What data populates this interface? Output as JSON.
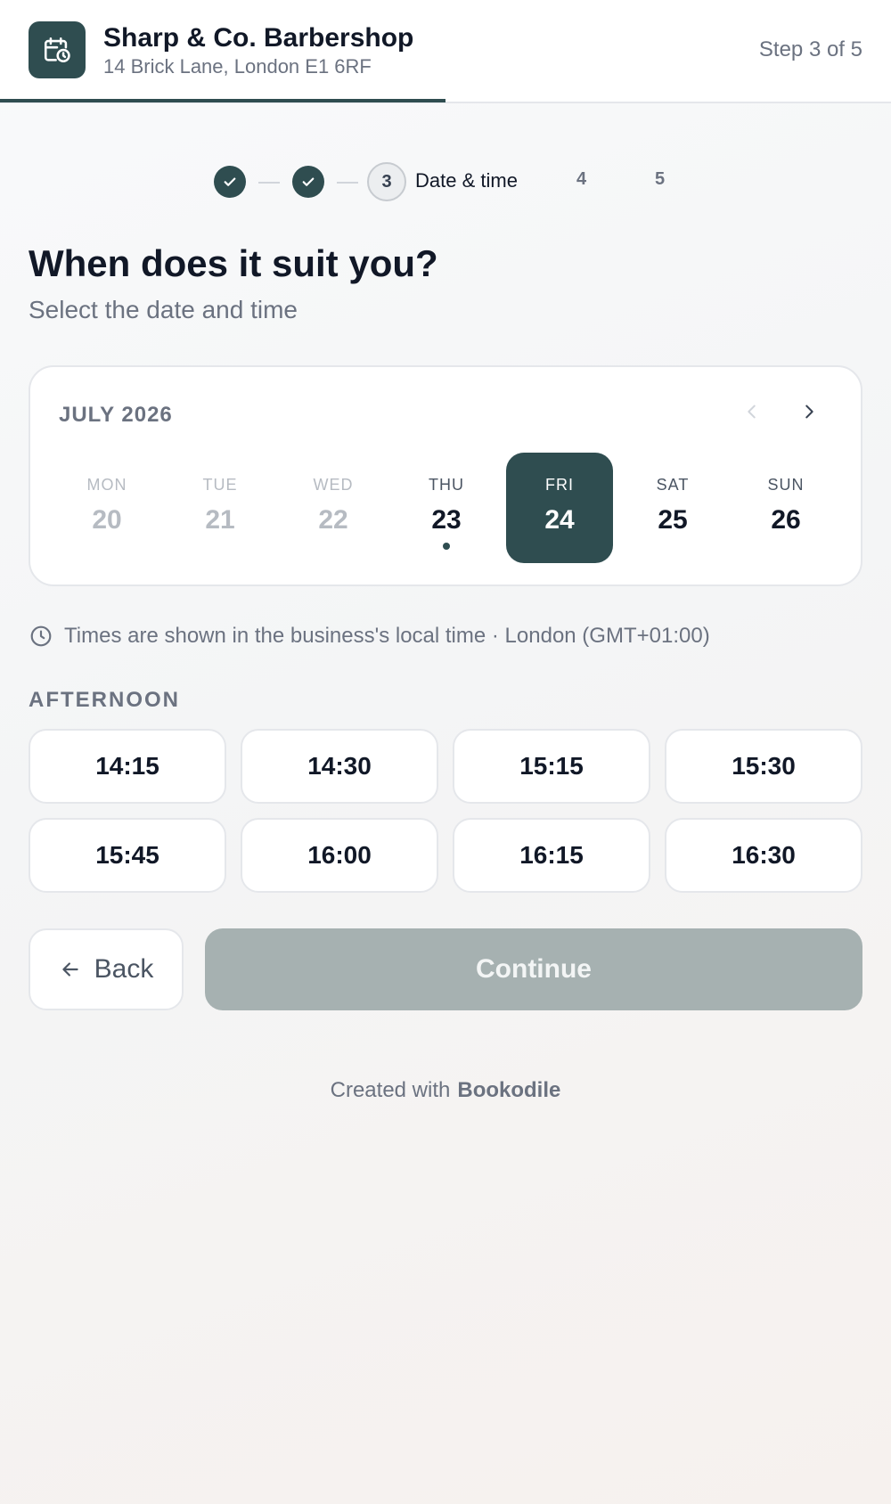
{
  "header": {
    "business_name": "Sharp & Co. Barbershop",
    "address": "14 Brick Lane, London E1 6RF",
    "step_text": "Step 3 of 5",
    "progress_fraction": 0.5,
    "logo_icon": "calendar-clock-icon"
  },
  "stepper": {
    "steps": [
      {
        "state": "done",
        "icon": "check-icon"
      },
      {
        "state": "done",
        "icon": "check-icon"
      },
      {
        "state": "current",
        "number": "3",
        "label": "Date & time"
      },
      {
        "state": "upcoming",
        "number": "4"
      },
      {
        "state": "upcoming",
        "number": "5"
      }
    ]
  },
  "main": {
    "title": "When does it suit you?",
    "subtitle": "Select the date and time"
  },
  "calendar": {
    "month_label": "JULY 2026",
    "prev_icon": "chevron-left-icon",
    "next_icon": "chevron-right-icon",
    "days": [
      {
        "weekday": "MON",
        "date": "20",
        "state": "past"
      },
      {
        "weekday": "TUE",
        "date": "21",
        "state": "past"
      },
      {
        "weekday": "WED",
        "date": "22",
        "state": "past"
      },
      {
        "weekday": "THU",
        "date": "23",
        "state": "today"
      },
      {
        "weekday": "FRI",
        "date": "24",
        "state": "selected"
      },
      {
        "weekday": "SAT",
        "date": "25",
        "state": "available"
      },
      {
        "weekday": "SUN",
        "date": "26",
        "state": "available"
      }
    ]
  },
  "timezone": {
    "icon": "clock-icon",
    "text": "Times are shown in the business's local time · London (GMT+01:00)"
  },
  "slots": {
    "period_label": "AFTERNOON",
    "times": [
      "14:15",
      "14:30",
      "15:15",
      "15:30",
      "15:45",
      "16:00",
      "16:15",
      "16:30"
    ]
  },
  "actions": {
    "back_label": "Back",
    "back_icon": "arrow-left-icon",
    "continue_label": "Continue"
  },
  "footer": {
    "created_with": "Created with",
    "brand": "Bookodile"
  },
  "colors": {
    "brand": "#2f4d50",
    "continue_disabled": "#a6b1b1",
    "muted_text": "#6b7280"
  }
}
